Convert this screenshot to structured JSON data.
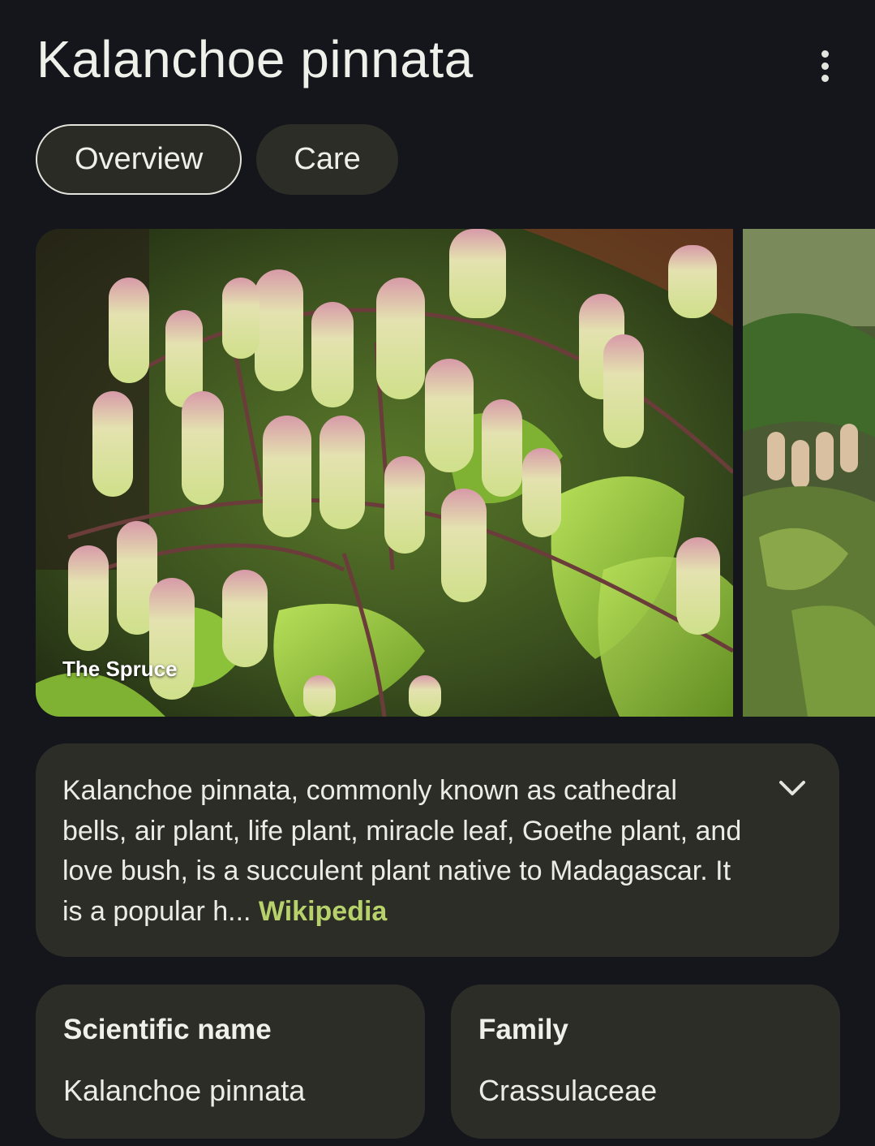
{
  "header": {
    "title": "Kalanchoe pinnata",
    "more_icon": "more-vert-icon"
  },
  "tabs": [
    {
      "label": "Overview",
      "active": true
    },
    {
      "label": "Care",
      "active": false
    }
  ],
  "gallery": {
    "images": [
      {
        "source": "The Spruce",
        "description_icon": "kalanchoe-flowers-photo"
      },
      {
        "description_icon": "kalanchoe-plant-photo"
      }
    ]
  },
  "description": {
    "text": "Kalanchoe pinnata, commonly known as cathedral bells, air plant, life plant, miracle leaf, Goethe plant, and love bush, is a succulent plant native to Madagascar. It is a popular h... ",
    "link": "Wikipedia",
    "expand_icon": "chevron-down-icon"
  },
  "facts": [
    {
      "label": "Scientific name",
      "value": "Kalanchoe pinnata"
    },
    {
      "label": "Family",
      "value": "Crassulaceae"
    }
  ],
  "colors": {
    "background": "#14161c",
    "card": "#2c2d27",
    "link": "#b7d26a",
    "text": "#ecece6"
  }
}
